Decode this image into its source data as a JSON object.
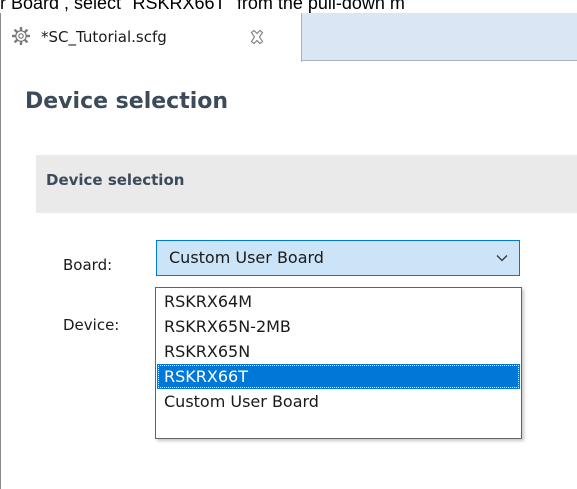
{
  "caption": {
    "text": "r Board , select \"RSKRX66T\" from the pull-down m"
  },
  "tab": {
    "title": "*SC_Tutorial.scfg",
    "icon": "gear-icon",
    "close_icon": "close-icon"
  },
  "editor": {
    "title": "Device selection"
  },
  "section": {
    "title": "Device selection"
  },
  "fields": {
    "board_label": "Board:",
    "device_label": "Device:"
  },
  "board_combo": {
    "selected_value": "Custom User Board",
    "arrow_icon": "chevron-down-icon"
  },
  "dropdown": {
    "options": [
      {
        "label": "RSKRX64M",
        "selected": false
      },
      {
        "label": "RSKRX65N-2MB",
        "selected": false
      },
      {
        "label": "RSKRX65N",
        "selected": false
      },
      {
        "label": "RSKRX66T",
        "selected": true
      },
      {
        "label": "Custom User Board",
        "selected": false
      }
    ]
  },
  "colors": {
    "highlight": "#0078d7",
    "combo_background": "#cce4f7",
    "tabbar_background": "#dae6f3",
    "section_background": "#eaeaea",
    "heading_text": "#3c4a5a"
  }
}
